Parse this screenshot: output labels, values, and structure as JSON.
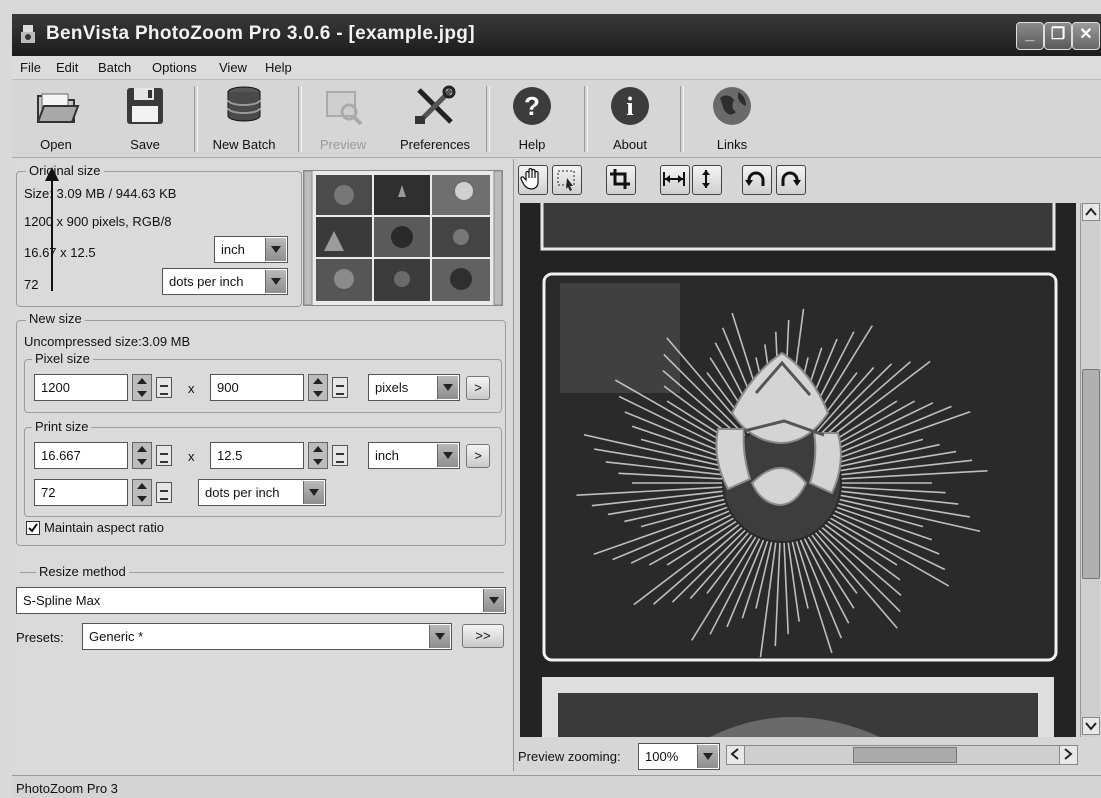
{
  "window": {
    "title": "BenVista PhotoZoom Pro 3.0.6 - [example.jpg]",
    "controls": [
      "minimize",
      "maximize",
      "close"
    ]
  },
  "menu": [
    "File",
    "Edit",
    "Batch",
    "Options",
    "View",
    "Help"
  ],
  "toolbar": [
    {
      "label": "Open",
      "icon": "folder-icon",
      "enabled": true
    },
    {
      "label": "Save",
      "icon": "floppy-disk-icon",
      "enabled": true
    },
    {
      "label": "New Batch",
      "icon": "database-icon",
      "enabled": true
    },
    {
      "label": "Preview",
      "icon": "preview-icon",
      "enabled": false
    },
    {
      "label": "Preferences",
      "icon": "tools-icon",
      "enabled": true
    },
    {
      "label": "Help",
      "icon": "question-icon",
      "enabled": true
    },
    {
      "label": "About",
      "icon": "info-icon",
      "enabled": true
    },
    {
      "label": "Links",
      "icon": "globe-icon",
      "enabled": true
    }
  ],
  "original_size": {
    "title": "Original size",
    "size_text": "Size: 3.09 MB / 944.63 KB",
    "pixels_text": "1200 x 900 pixels, RGB/8",
    "print_dims": "16.67 x 12.5",
    "resolution": "72",
    "unit": "inch",
    "res_unit": "dots per inch"
  },
  "new_size": {
    "title": "New size",
    "uncompressed": "Uncompressed size:3.09 MB",
    "pixel_size": {
      "title": "Pixel size",
      "width": "1200",
      "height": "900",
      "unit": "pixels",
      "x": "x",
      "more": ">"
    },
    "print_size": {
      "title": "Print size",
      "width": "16.667",
      "height": "12.5",
      "unit": "inch",
      "resolution": "72",
      "res_unit": "dots per inch",
      "x": "x",
      "more": ">"
    },
    "aspect_label": "Maintain aspect ratio",
    "aspect_checked": true
  },
  "resize": {
    "title": "Resize method",
    "method": "S-Spline Max",
    "presets_label": "Presets:",
    "preset": "Generic *",
    "more": ">>"
  },
  "preview": {
    "zoom_label": "Preview zooming:",
    "zoom": "100%"
  },
  "status": "PhotoZoom Pro 3",
  "colors": {
    "titlebar": "#2a2a2a",
    "panel": "#dadada",
    "field": "#ffffff"
  }
}
